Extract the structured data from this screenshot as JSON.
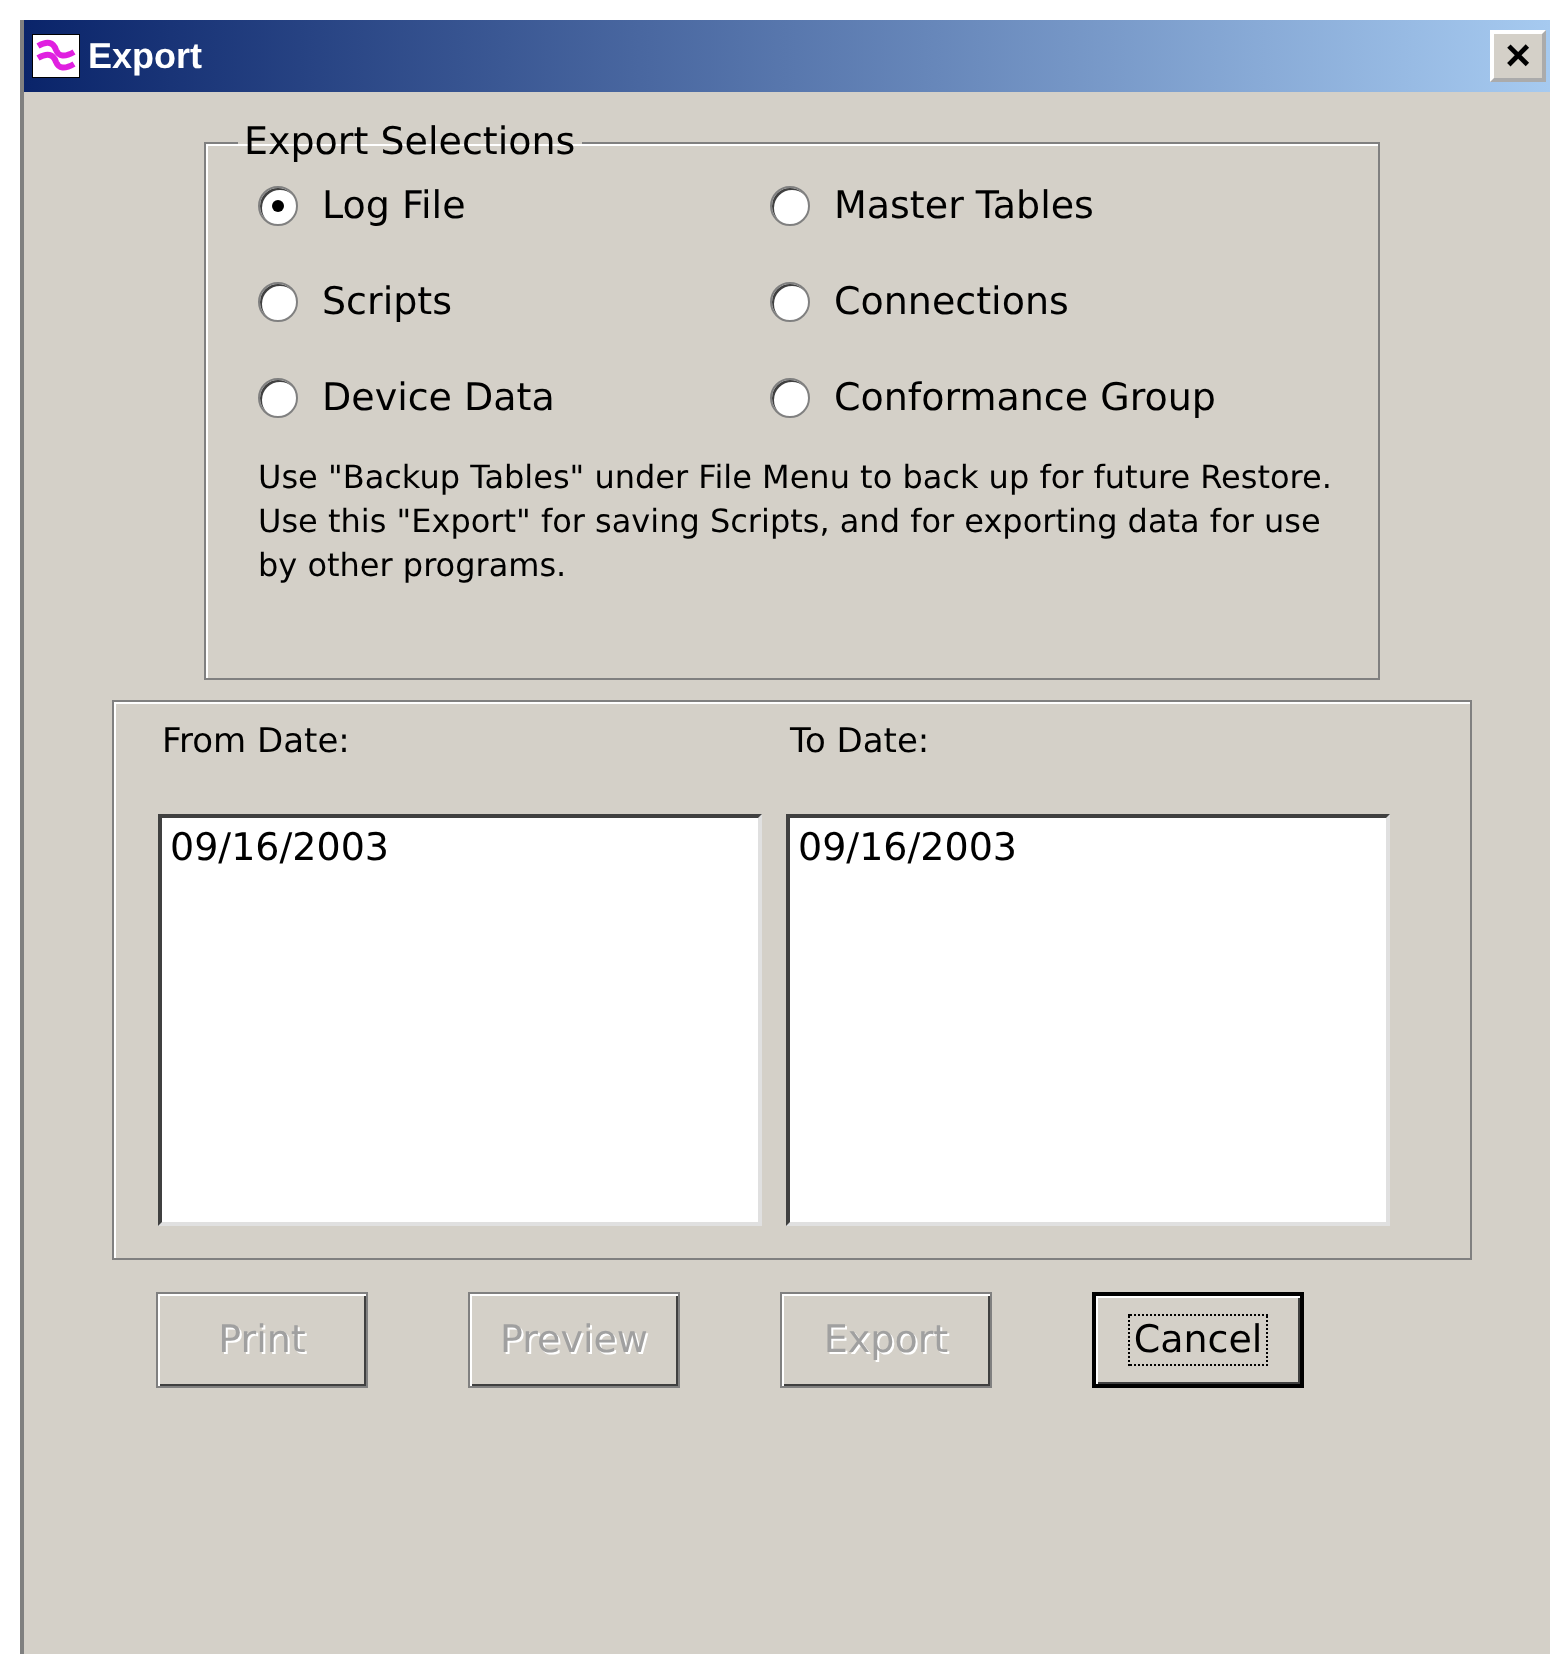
{
  "window": {
    "title": "Export",
    "close": "×"
  },
  "export_selections": {
    "title": "Export Selections",
    "options": [
      {
        "label": "Log File",
        "selected": true
      },
      {
        "label": "Master Tables",
        "selected": false
      },
      {
        "label": "Scripts",
        "selected": false
      },
      {
        "label": "Connections",
        "selected": false
      },
      {
        "label": "Device Data",
        "selected": false
      },
      {
        "label": "Conformance Group",
        "selected": false
      }
    ],
    "note": "Use \"Backup Tables\" under File Menu to back up for future Restore. Use this \"Export\" for saving Scripts, and for exporting data for use by other programs."
  },
  "dates": [
    {
      "label": "From Date:",
      "items": [
        "09/16/2003"
      ]
    },
    {
      "label": "To Date:",
      "items": [
        "09/16/2003"
      ]
    }
  ],
  "buttons": [
    {
      "label": "Print",
      "disabled": true,
      "focused": false
    },
    {
      "label": "Preview",
      "disabled": true,
      "focused": false
    },
    {
      "label": "Export",
      "disabled": true,
      "focused": false
    },
    {
      "label": "Cancel",
      "disabled": false,
      "focused": true
    }
  ]
}
